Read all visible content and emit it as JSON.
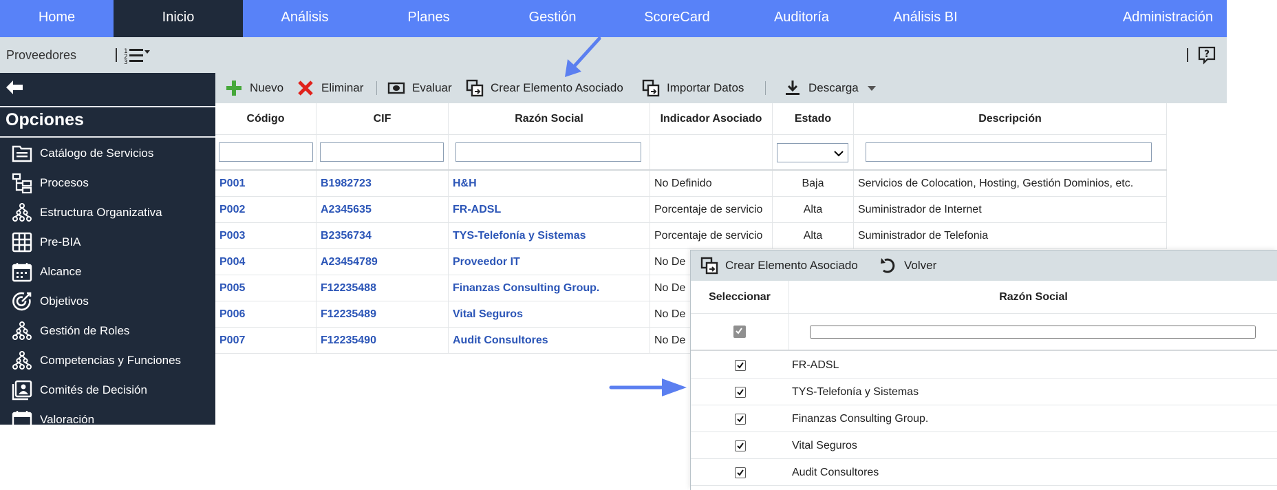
{
  "topnav": {
    "tabs": [
      {
        "label": "Home",
        "active": false
      },
      {
        "label": "Inicio",
        "active": true
      },
      {
        "label": "Análisis",
        "active": false
      },
      {
        "label": "Planes",
        "active": false
      },
      {
        "label": "Gestión",
        "active": false
      },
      {
        "label": "ScoreCard",
        "active": false
      },
      {
        "label": "Auditoría",
        "active": false
      },
      {
        "label": "Análisis BI",
        "active": false
      },
      {
        "label": "Administración",
        "active": false
      }
    ]
  },
  "subbar": {
    "title": "Proveedores"
  },
  "sidebar": {
    "heading": "Opciones",
    "items": [
      {
        "label": "Catálogo de Servicios",
        "icon": "catalog-icon"
      },
      {
        "label": "Procesos",
        "icon": "process-icon"
      },
      {
        "label": "Estructura Organizativa",
        "icon": "org-structure-icon"
      },
      {
        "label": "Pre-BIA",
        "icon": "grid-icon"
      },
      {
        "label": "Alcance",
        "icon": "calendar-icon"
      },
      {
        "label": "Objetivos",
        "icon": "target-icon"
      },
      {
        "label": "Gestión de Roles",
        "icon": "org-structure-icon"
      },
      {
        "label": "Competencias y Funciones",
        "icon": "org-structure-icon"
      },
      {
        "label": "Comités de Decisión",
        "icon": "committee-icon"
      },
      {
        "label": "Valoración",
        "icon": "calendar-icon"
      }
    ]
  },
  "toolbar": {
    "nuevo": "Nuevo",
    "eliminar": "Eliminar",
    "evaluar": "Evaluar",
    "crear": "Crear Elemento Asociado",
    "importar": "Importar Datos",
    "descarga": "Descarga"
  },
  "table": {
    "columns": [
      "Código",
      "CIF",
      "Razón Social",
      "Indicador Asociado",
      "Estado",
      "Descripción"
    ],
    "rows": [
      {
        "codigo": "P001",
        "cif": "B1982723",
        "razon": "H&H",
        "indicador": "No Definido",
        "estado": "Baja",
        "descripcion": "Servicios de Colocation, Hosting, Gestión Dominios, etc."
      },
      {
        "codigo": "P002",
        "cif": "A2345635",
        "razon": "FR-ADSL",
        "indicador": "Porcentaje de servicio",
        "estado": "Alta",
        "descripcion": "Suministrador de Internet"
      },
      {
        "codigo": "P003",
        "cif": "B2356734",
        "razon": "TYS-Telefonía y Sistemas",
        "indicador": "Porcentaje de servicio",
        "estado": "Alta",
        "descripcion": "Suministrador de Telefonia"
      },
      {
        "codigo": "P004",
        "cif": "A23454789",
        "razon": "Proveedor IT",
        "indicador": "No De",
        "estado": "",
        "descripcion": ""
      },
      {
        "codigo": "P005",
        "cif": "F12235488",
        "razon": "Finanzas Consulting Group.",
        "indicador": "No De",
        "estado": "",
        "descripcion": ""
      },
      {
        "codigo": "P006",
        "cif": "F12235489",
        "razon": "Vital Seguros",
        "indicador": "No De",
        "estado": "",
        "descripcion": ""
      },
      {
        "codigo": "P007",
        "cif": "F12235490",
        "razon": "Audit Consultores",
        "indicador": "No De",
        "estado": "",
        "descripcion": ""
      }
    ]
  },
  "popup": {
    "crear": "Crear Elemento Asociado",
    "volver": "Volver",
    "columns": [
      "Seleccionar",
      "Razón Social"
    ],
    "rows": [
      {
        "razon": "FR-ADSL",
        "checked": true
      },
      {
        "razon": "TYS-Telefonía y Sistemas",
        "checked": true
      },
      {
        "razon": "Finanzas Consulting Group.",
        "checked": true
      },
      {
        "razon": "Vital Seguros",
        "checked": true
      },
      {
        "razon": "Audit Consultores",
        "checked": true
      }
    ]
  },
  "colors": {
    "nav_blue": "#5882f8",
    "nav_active": "#1f2a3a",
    "bar_grey": "#d7dfe3",
    "sidebar_dark": "#1f2a3a",
    "link_blue": "#2b55b7",
    "arrow_blue": "#5b7ff0"
  }
}
